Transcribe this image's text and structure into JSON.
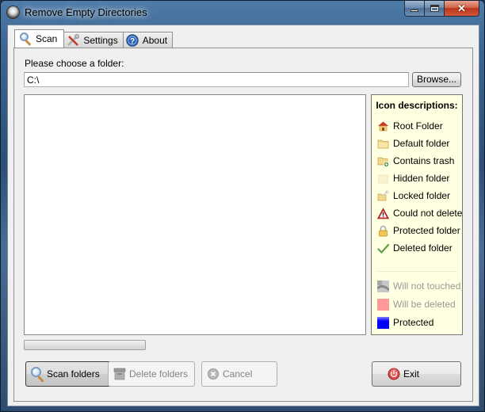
{
  "window": {
    "title": "Remove Empty Directories",
    "controls": {
      "minimize": "minimize",
      "maximize": "maximize",
      "close": "✕"
    }
  },
  "tabs": [
    {
      "label": "Scan",
      "icon": "magnifier-icon",
      "active": true
    },
    {
      "label": "Settings",
      "icon": "tools-icon",
      "active": false
    },
    {
      "label": "About",
      "icon": "help-icon",
      "active": false
    }
  ],
  "scan": {
    "folder_label": "Please choose a folder:",
    "folder_value": "C:\\",
    "browse_label": "Browse...",
    "progress": 0
  },
  "legend": {
    "title": "Icon descriptions:",
    "items": [
      {
        "label": "Root Folder",
        "icon": "root-folder-icon"
      },
      {
        "label": "Default folder",
        "icon": "default-folder-icon"
      },
      {
        "label": "Contains trash",
        "icon": "trash-folder-icon"
      },
      {
        "label": "Hidden folder",
        "icon": "hidden-folder-icon"
      },
      {
        "label": "Locked folder",
        "icon": "locked-folder-icon"
      },
      {
        "label": "Could not delete",
        "icon": "warning-icon"
      },
      {
        "label": "Protected folder",
        "icon": "padlock-icon"
      },
      {
        "label": "Deleted folder",
        "icon": "checkmark-icon"
      }
    ],
    "colors": [
      {
        "label": "Will not touched",
        "color": "#a8a8a8",
        "dim": true
      },
      {
        "label": "Will be deleted",
        "color": "#ff9999",
        "dim": true
      },
      {
        "label": "Protected",
        "color": "#0000ff",
        "dim": false
      }
    ]
  },
  "buttons": {
    "scan": "Scan folders",
    "delete": "Delete folders",
    "cancel": "Cancel",
    "exit": "Exit"
  }
}
